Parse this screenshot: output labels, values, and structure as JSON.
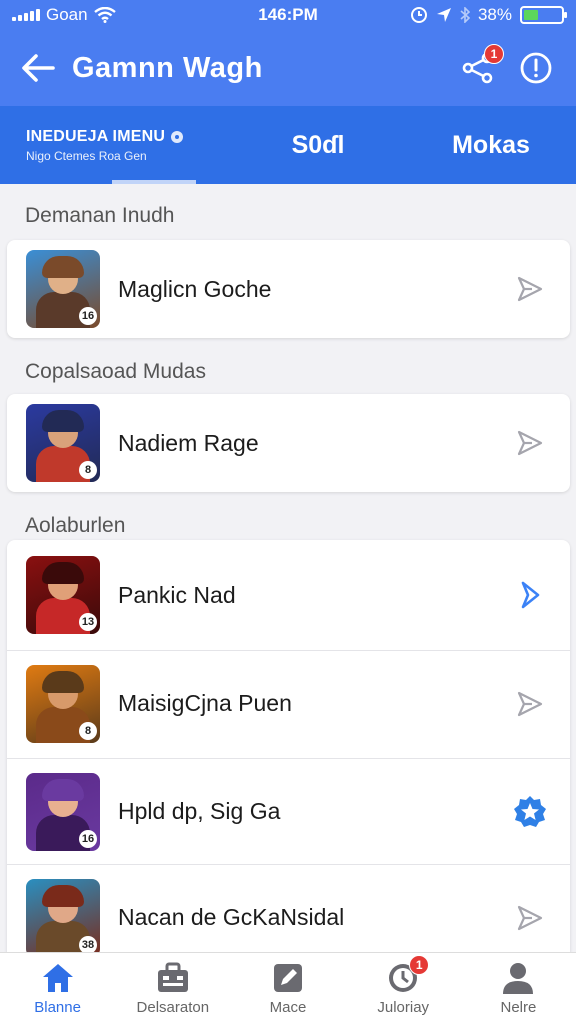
{
  "status_bar": {
    "carrier": "Goan",
    "time": "146:PM",
    "battery": "38%",
    "battery_level": 0.38
  },
  "app_bar": {
    "title": "Gamnn Wagh",
    "share_badge": "1"
  },
  "tabs": [
    {
      "line1": "INEDUEJA IMENU",
      "line2": "Nigo Ctemes Roa Gen"
    },
    {
      "label": "S0ɗl"
    },
    {
      "label": "Mokas"
    }
  ],
  "sections": [
    {
      "header": "Demanan Inudh"
    },
    {
      "header": "Copalsaoad Mudas"
    },
    {
      "header": "Aolaburlen"
    }
  ],
  "games": [
    {
      "title": "Maglicn Goche",
      "level": "16",
      "action": "send-icon",
      "colors": [
        "#3a8fd6",
        "#7a4a2a",
        "#e0b088",
        "#5a3a2a"
      ]
    },
    {
      "title": "Nadiem Rage",
      "level": "8",
      "action": "send-icon",
      "colors": [
        "#2b3aa0",
        "#222a55",
        "#d9a27a",
        "#c0392b"
      ]
    },
    {
      "title": "Pankic Nad",
      "level": "13",
      "action": "chevron-right-icon",
      "colors": [
        "#8a1010",
        "#3a0a0a",
        "#e0a078",
        "#c62828"
      ]
    },
    {
      "title": "MaisigCjna Puen",
      "level": "8",
      "action": "send-icon",
      "colors": [
        "#e07b12",
        "#5a3a1a",
        "#d89a6a",
        "#8a4a1a"
      ]
    },
    {
      "title": "Hpld dp, Sig Ga",
      "level": "16",
      "action": "star-badge-icon",
      "colors": [
        "#5b2a8a",
        "#6a3aa0",
        "#e8b090",
        "#3a1a5a"
      ]
    },
    {
      "title": "Nacan de GcKaNsidal",
      "level": "38",
      "action": "send-icon",
      "colors": [
        "#2a8fc0",
        "#7a2a1a",
        "#e0a888",
        "#6a4a2a"
      ]
    }
  ],
  "bottom_nav": [
    {
      "label": "Blanne",
      "icon": "home-icon",
      "active": true
    },
    {
      "label": "Delsaraton",
      "icon": "briefcase-icon",
      "active": false
    },
    {
      "label": "Mace",
      "icon": "edit-icon",
      "active": false
    },
    {
      "label": "Juloriay",
      "icon": "clock-icon",
      "active": false,
      "badge": "1"
    },
    {
      "label": "Nelre",
      "icon": "person-icon",
      "active": false
    }
  ]
}
